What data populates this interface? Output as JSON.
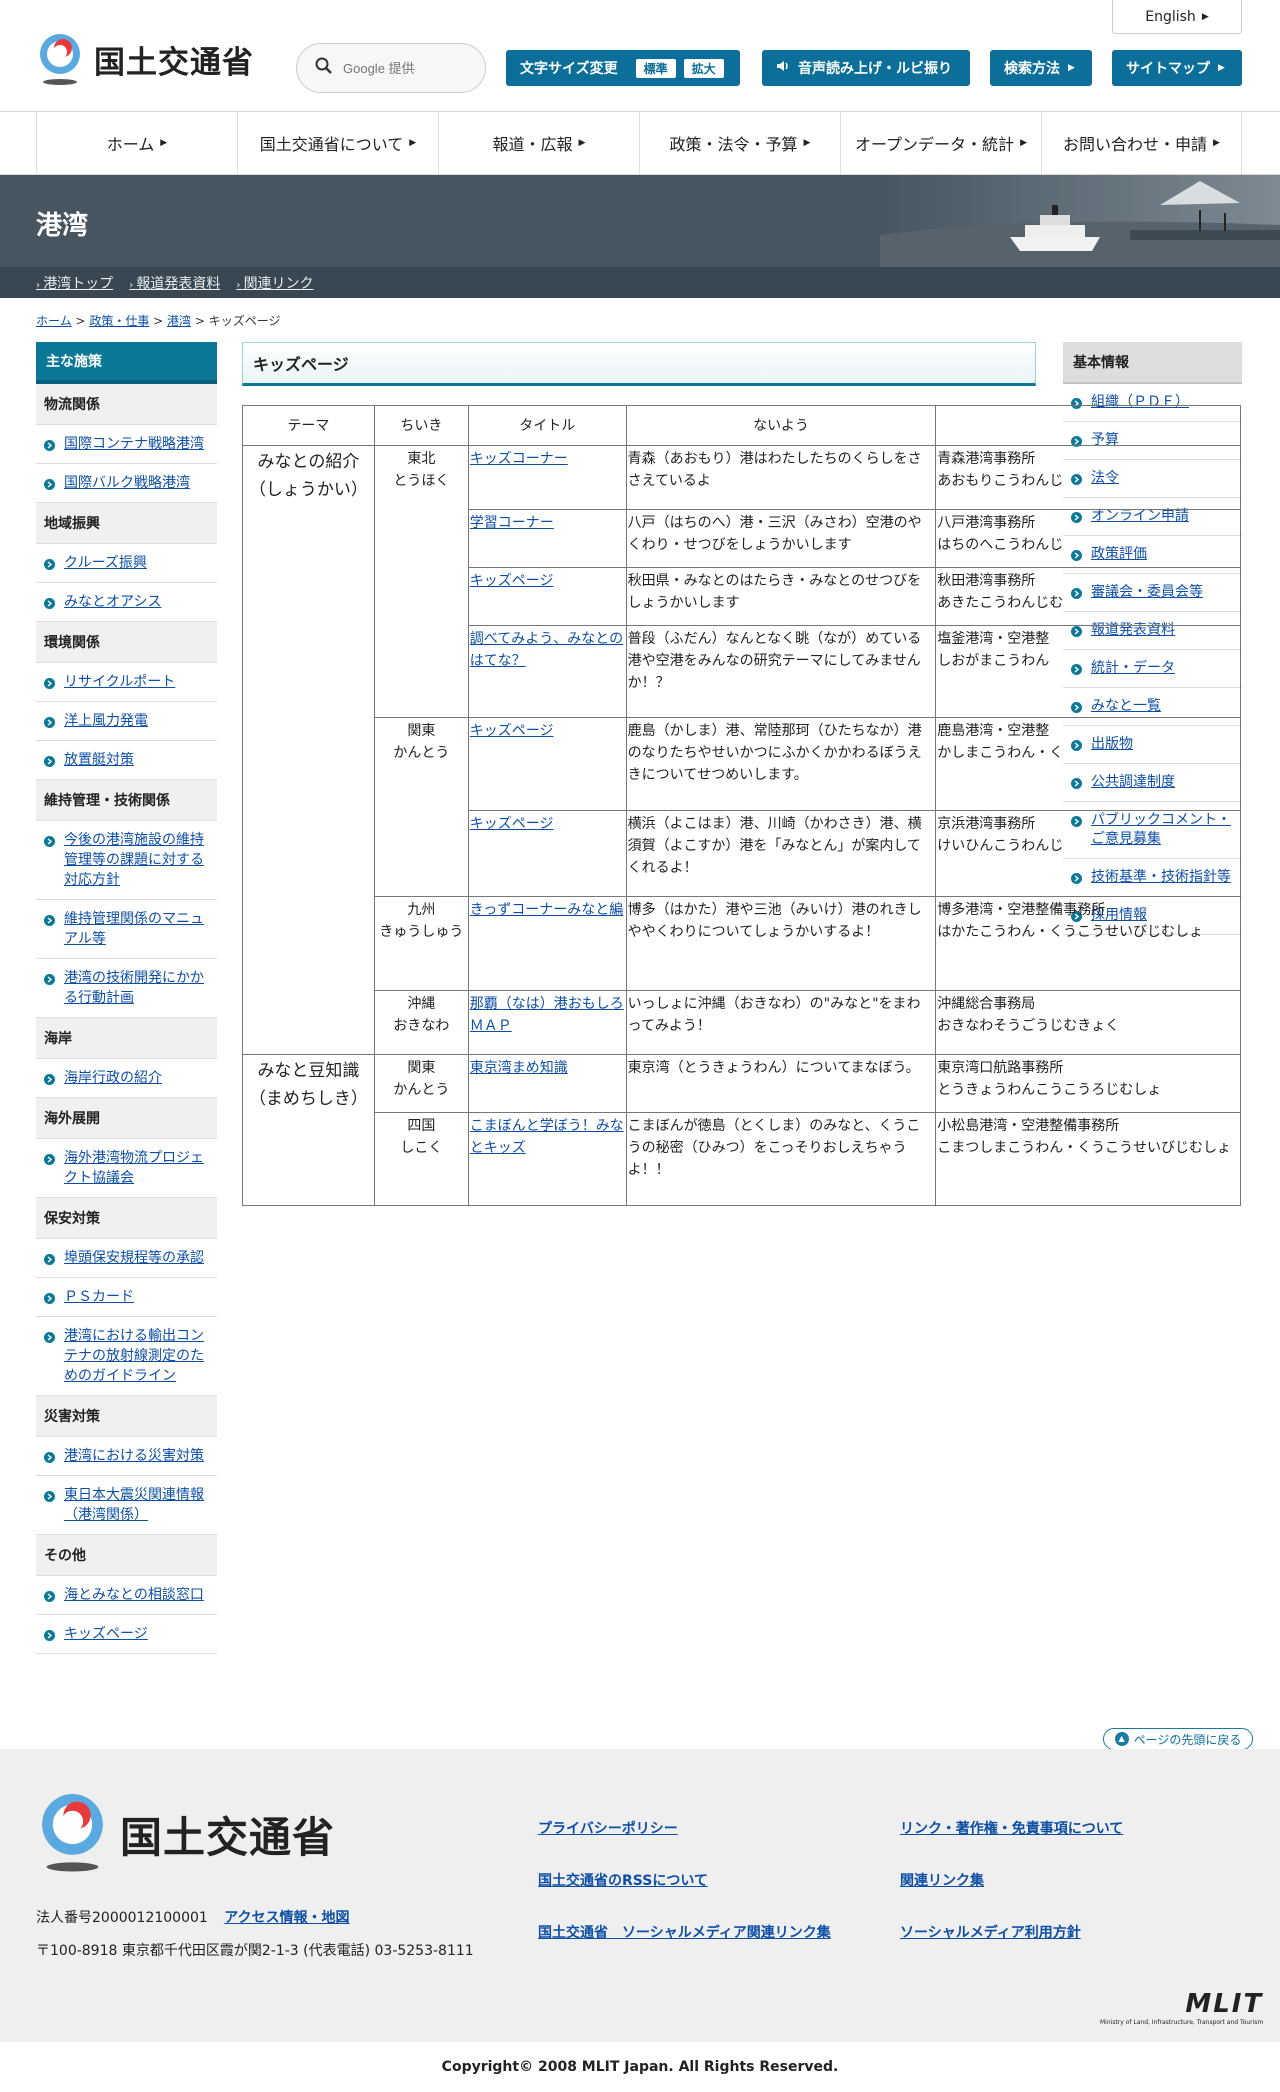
{
  "header": {
    "org_name": "国土交通省",
    "search_placeholder": "Google 提供",
    "english": "English",
    "font_size_label": "文字サイズ変更",
    "font_size_normal": "標準",
    "font_size_large": "拡大",
    "speech": "音声読み上げ・ルビ振り",
    "search_method": "検索方法",
    "sitemap": "サイトマップ"
  },
  "gnav": [
    "ホーム",
    "国土交通省について",
    "報道・広報",
    "政策・法令・予算",
    "オープンデータ・統計",
    "お問い合わせ・申請"
  ],
  "banner": {
    "title": "港湾"
  },
  "subnav": [
    "港湾トップ",
    "報道発表資料",
    "関連リンク"
  ],
  "breadcrumb": {
    "items": [
      "ホーム",
      "政策・仕事",
      "港湾"
    ],
    "current": "キッズページ",
    "sep": " > "
  },
  "left_sidebar": {
    "title": "主な施策",
    "sections": [
      {
        "category": "物流関係",
        "links": [
          "国際コンテナ戦略港湾",
          "国際バルク戦略港湾"
        ]
      },
      {
        "category": "地域振興",
        "links": [
          "クルーズ振興",
          "みなとオアシス"
        ]
      },
      {
        "category": "環境関係",
        "links": [
          "リサイクルポート",
          "洋上風力発電",
          "放置艇対策"
        ]
      },
      {
        "category": "維持管理・技術関係",
        "links": [
          "今後の港湾施設の維持管理等の課題に対する対応方針",
          "維持管理関係のマニュアル等",
          "港湾の技術開発にかかる行動計画"
        ]
      },
      {
        "category": "海岸",
        "links": [
          "海岸行政の紹介"
        ]
      },
      {
        "category": "海外展開",
        "links": [
          "海外港湾物流プロジェクト協議会"
        ]
      },
      {
        "category": "保安対策",
        "links": [
          "埠頭保安規程等の承認",
          "ＰＳカード",
          "港湾における輸出コンテナの放射線測定のためのガイドライン"
        ]
      },
      {
        "category": "災害対策",
        "links": [
          "港湾における災害対策",
          "東日本大震災関連情報（港湾関係）"
        ]
      },
      {
        "category": "その他",
        "links": [
          "海とみなとの相談窓口",
          "キッズページ"
        ]
      }
    ]
  },
  "right_sidebar": {
    "title": "基本情報",
    "links": [
      "組織（ＰＤＦ）",
      "予算",
      "法令",
      "オンライン申請",
      "政策評価",
      "審議会・委員会等",
      "報道発表資料",
      "統計・データ",
      "みなと一覧",
      "出版物",
      "公共調達制度",
      "パブリックコメント・ご意見募集",
      "技術基準・技術指針等",
      "採用情報"
    ]
  },
  "main": {
    "title": "キッズページ",
    "table": {
      "headers": [
        "テーマ",
        "ちいき",
        "タイトル",
        "ないよう",
        ""
      ],
      "rows": [
        {
          "theme": "みなとの紹介（しょうかい）",
          "region": "東北\nとうほく",
          "title": "キッズコーナー",
          "content": "青森（あおもり）港はわたしたちのくらしをささえているよ",
          "office": "青森港湾事務所\nあおもりこうわんじ"
        },
        {
          "title": "学習コーナー",
          "content": "八戸（はちのへ）港・三沢（みさわ）空港のやくわり・せつびをしょうかいします",
          "office": "八戸港湾事務所\nはちのへこうわんじ"
        },
        {
          "title": "キッズページ",
          "content": "秋田県・みなとのはたらき・みなとのせつびをしょうかいします",
          "office": "秋田港湾事務所\nあきたこうわんじむ"
        },
        {
          "title": "調べてみよう、みなとのはてな？",
          "content": "普段（ふだん）なんとなく眺（なが）めている港や空港をみんなの研究テーマにしてみませんか！？",
          "office": "塩釜港湾・空港整\nしおがまこうわん"
        },
        {
          "region": "関東\nかんとう",
          "title": "キッズページ",
          "content": "鹿島（かしま）港、常陸那珂（ひたちなか）港のなりたちやせいかつにふかくかかわるぼうえきについてせつめいします。",
          "office": "鹿島港湾・空港整\nかしまこうわん・く"
        },
        {
          "title": "キッズページ",
          "content": "横浜（よこはま）港、川崎（かわさき）港、横須賀（よこすか）港を「みなとん」が案内してくれるよ！",
          "office": "京浜港湾事務所\nけいひんこうわんじ"
        },
        {
          "region": "九州\nきゅうしゅう",
          "title": "きっずコーナーみなと編",
          "content": "博多（はかた）港や三池（みいけ）港のれきしややくわりについてしょうかいするよ！",
          "office": "博多港湾・空港整備事務所\nはかたこうわん・くうこうせいびじむしょ"
        },
        {
          "region": "沖縄\nおきなわ",
          "title": "那覇（なは）港おもしろＭＡＰ",
          "content": "いっしょに沖縄（おきなわ）の\"みなと\"をまわってみよう！",
          "office": "沖縄総合事務局\nおきなわそうごうじむきょく"
        },
        {
          "theme": "みなと豆知識（まめちしき）",
          "region": "関東\nかんとう",
          "title": "東京湾まめ知識",
          "content": "東京湾（とうきょうわん）についてまなぼう。",
          "office": "東京湾口航路事務所\nとうきょうわんこうこうろじむしょ"
        },
        {
          "region": "四国\nしこく",
          "title": "こまぼんと学ぼう！みなとキッズ",
          "content": "こまぼんが徳島（とくしま）のみなと、くうこうの秘密（ひみつ）をこっそりおしえちゃうよ！！",
          "office": "小松島港湾・空港整備事務所\nこまつしまこうわん・くうこうせいびじむしょ"
        }
      ]
    }
  },
  "footer": {
    "goto_top": "ページの先頭に戻る",
    "org_name": "国土交通省",
    "corp_number": "法人番号2000012100001",
    "access": "アクセス情報・地図",
    "address": "〒100-8918 東京都千代田区霞が関2-1-3 (代表電話) 03-5253-8111",
    "links": [
      "プライバシーポリシー",
      "リンク・著作権・免責事項について",
      "国土交通省のRSSについて",
      "関連リンク集",
      "国土交通省　ソーシャルメディア関連リンク集",
      "ソーシャルメディア利用方針"
    ],
    "mlit": "MLIT",
    "mlit_sub": "Ministry of Land, Infrastructure, Transport and Tourism",
    "copyright": "Copyright© 2008 MLIT Japan. All Rights Reserved."
  },
  "colors": {
    "accent": "#0b6f9a",
    "banner": "#475560",
    "link": "#0e4fa6"
  }
}
